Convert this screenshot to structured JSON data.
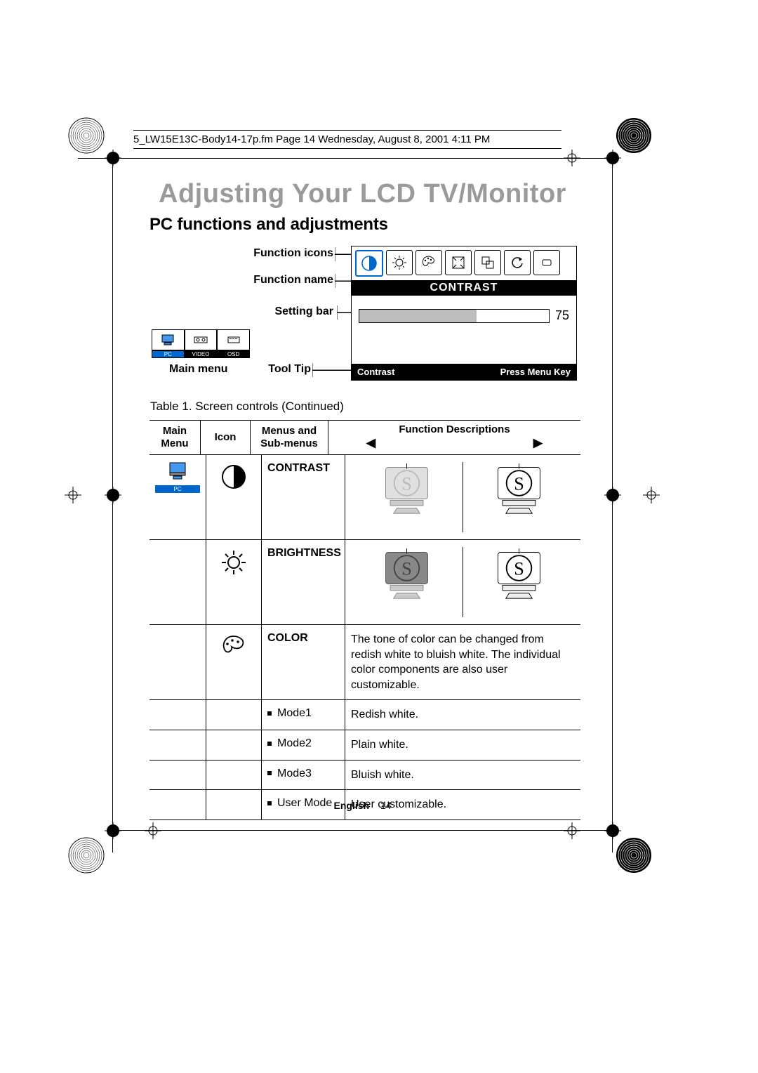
{
  "fileHeader": "5_LW15E13C-Body14-17p.fm  Page 14  Wednesday, August 8, 2001  4:11 PM",
  "pageTitle": "Adjusting Your LCD TV/Monitor",
  "sectionTitle": "PC functions and adjustments",
  "labels": {
    "functionIcons": "Function icons",
    "functionName": "Function name",
    "settingBar": "Setting bar",
    "toolTip": "Tool Tip",
    "mainMenu": "Main menu"
  },
  "osd": {
    "funcName": "CONTRAST",
    "value": "75",
    "bottomLeft": "Contrast",
    "bottomRight": "Press Menu Key"
  },
  "mainMenuTabs": [
    "PC",
    "VIDEO",
    "OSD"
  ],
  "tableCaption": "Table 1.  Screen controls (Continued)",
  "tableHeader": {
    "mainMenu": "Main Menu",
    "icon": "Icon",
    "menus": "Menus and Sub-menus",
    "desc": "Function Descriptions",
    "arrowLeft": "◀",
    "arrowRight": "▶"
  },
  "rows": {
    "contrastLabel": "CONTRAST",
    "brightnessLabel": "BRIGHTNESS",
    "colorLabel": "COLOR",
    "colorDesc": "The tone of color can be changed from redish white to bluish white. The individual color components are also user customizable.",
    "mode1": "Mode1",
    "mode1Desc": "Redish white.",
    "mode2": "Mode2",
    "mode2Desc": "Plain white.",
    "mode3": "Mode3",
    "mode3Desc": "Bluish white.",
    "userMode": "User Mode",
    "userModeDesc": "User customizable."
  },
  "footerLang": "English",
  "footerPage": "14"
}
